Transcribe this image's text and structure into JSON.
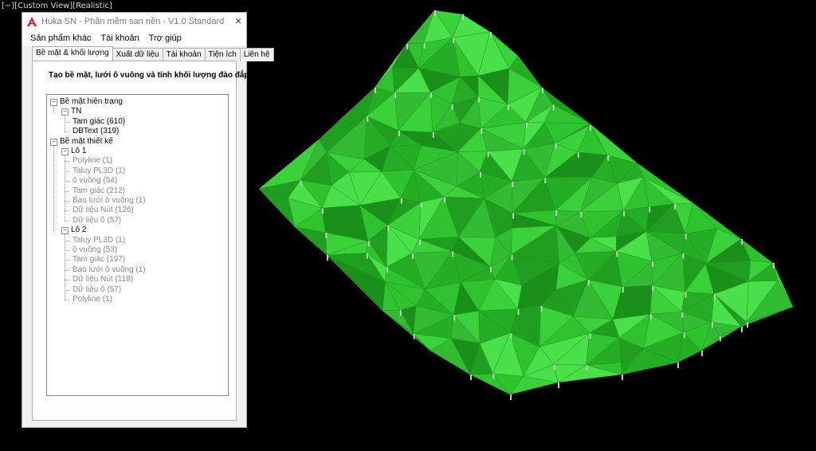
{
  "viewport": {
    "label": "[−][Custom View][Realistic]"
  },
  "window": {
    "title": "Huka SN - Phần mềm san nền - V1.0 Standard",
    "close_icon": "×",
    "menu": [
      "Sản phẩm khác",
      "Tài khoản",
      "Trợ giúp"
    ],
    "tabs": [
      "Bề mặt & khối lượng",
      "Xuất dữ liệu",
      "Tài khoản",
      "Tiện ích",
      "Liên hệ"
    ],
    "active_tab": 0,
    "heading": "Tạo bề mặt, lưới ô vuông và tính khối lượng đào đắp"
  },
  "tree": [
    {
      "label": "Bề mặt hiện trạng",
      "level": 0,
      "toggle": "−",
      "style": "dark"
    },
    {
      "label": "TN",
      "level": 1,
      "toggle": "−",
      "style": "dark"
    },
    {
      "label": "Tam giác (610)",
      "level": 2,
      "style": "dark"
    },
    {
      "label": "DBText (319)",
      "level": 2,
      "style": "dark"
    },
    {
      "label": "Bề mặt thiết kế",
      "level": 0,
      "toggle": "−",
      "style": "dark"
    },
    {
      "label": "Lô 1",
      "level": 1,
      "toggle": "−",
      "style": "dark"
    },
    {
      "label": "Polyline (1)",
      "level": 2,
      "style": "dim"
    },
    {
      "label": "Taluy PL3D (1)",
      "level": 2,
      "style": "dim"
    },
    {
      "label": "ô vuông (54)",
      "level": 2,
      "style": "dim"
    },
    {
      "label": "Tam giác (212)",
      "level": 2,
      "style": "dim"
    },
    {
      "label": "Bao lưới ô vuông (1)",
      "level": 2,
      "style": "dim"
    },
    {
      "label": "Dữ liệu Nút (126)",
      "level": 2,
      "style": "dim"
    },
    {
      "label": "Dữ liệu ô (57)",
      "level": 2,
      "style": "dim"
    },
    {
      "label": "Lô 2",
      "level": 1,
      "toggle": "−",
      "style": "dark"
    },
    {
      "label": "Taluy PL3D (1)",
      "level": 2,
      "style": "dim"
    },
    {
      "label": "ô vuông (53)",
      "level": 2,
      "style": "dim"
    },
    {
      "label": "Tam giác (197)",
      "level": 2,
      "style": "dim"
    },
    {
      "label": "Bao lưới ô vuông (1)",
      "level": 2,
      "style": "dim"
    },
    {
      "label": "Dữ liệu Nút (118)",
      "level": 2,
      "style": "dim"
    },
    {
      "label": "Dữ liệu ô (57)",
      "level": 2,
      "style": "dim"
    },
    {
      "label": "Polyline (1)",
      "level": 2,
      "style": "dim"
    }
  ],
  "colors": {
    "surface": "#2fc32f",
    "surface_dark": "#1a8f1a",
    "surface_light": "#49e049",
    "label_marks": "#c8c8c8"
  }
}
